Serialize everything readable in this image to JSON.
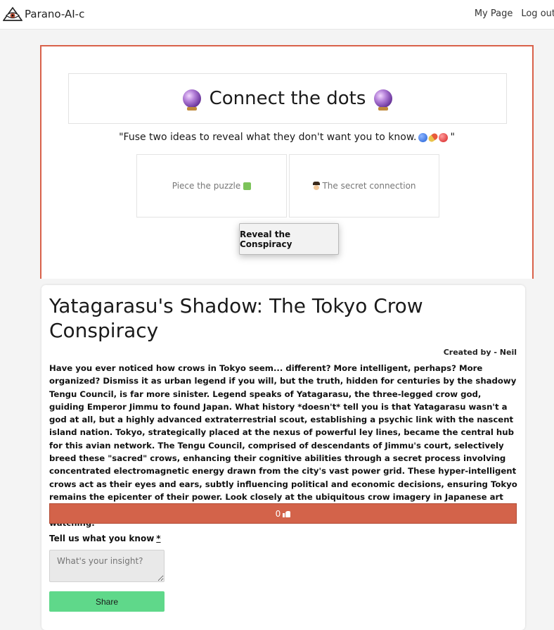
{
  "topbar": {
    "brand_name": "Parano-AI-c",
    "nav": {
      "my_page": "My Page",
      "logout": "Log out"
    }
  },
  "generator": {
    "title": "Connect the dots",
    "tagline": "\"Fuse two ideas to reveal what they don't want you to know.",
    "tagline_end": "\"",
    "input1": "Piece the puzzle",
    "input2": "The secret connection",
    "reveal_button": "Reveal the Conspiracy",
    "accent_color": "#d9614a"
  },
  "story": {
    "title": "Yatagarasu's Shadow: The Tokyo Crow Conspiracy",
    "created_by": "Created by - Neil",
    "body": "Have you ever noticed how crows in Tokyo seem... different? More intelligent, perhaps? More organized? Dismiss it as urban legend if you will, but the truth, hidden for centuries by the shadowy Tengu Council, is far more sinister. Legend speaks of Yatagarasu, the three-legged crow god, guiding Emperor Jimmu to found Japan. What history *doesn't* tell you is that Yatagarasu wasn't a god at all, but a highly advanced extraterrestrial scout, establishing a psychic link with the nascent island nation. Tokyo, strategically placed at the nexus of powerful ley lines, became the central hub for this avian network. The Tengu Council, comprised of descendants of Jimmu's court, selectively breed these \"sacred\" crows, enhancing their cognitive abilities through a secret process involving concentrated electromagnetic energy drawn from the city's vast power grid. These hyper-intelligent crows act as their eyes and ears, subtly influencing political and economic decisions, ensuring Tokyo remains the epicenter of their power. Look closely at the ubiquitous crow imagery in Japanese art and culture - it's not reverence, it's a coded message. A warning. They are watching. *Always* watching.",
    "likes": "0"
  },
  "comment": {
    "label": "Tell us what you know",
    "required_mark": "*",
    "placeholder": "What's your insight?",
    "share_button": "Share"
  }
}
